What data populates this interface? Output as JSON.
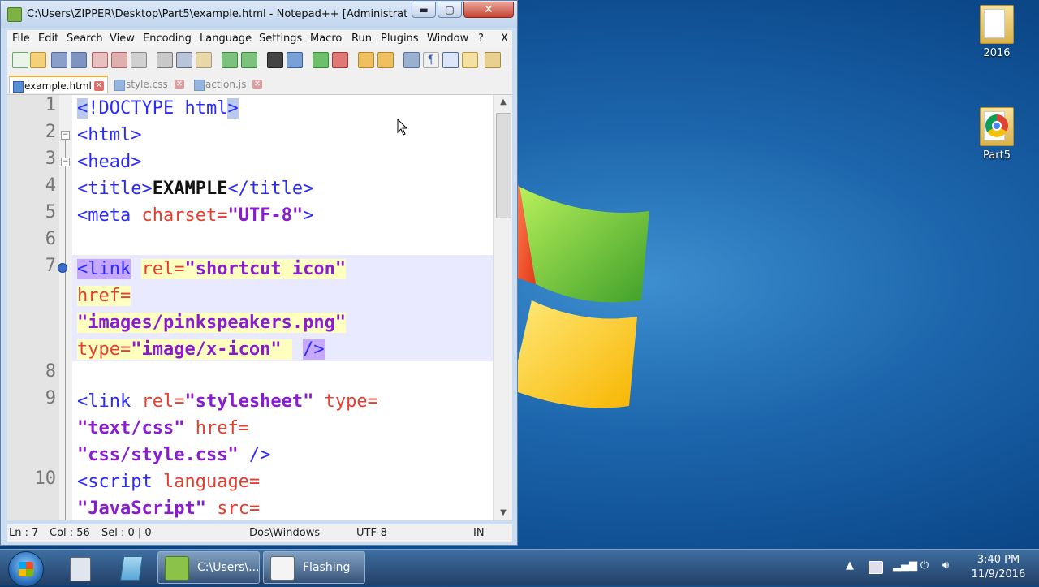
{
  "window": {
    "title": "C:\\Users\\ZIPPER\\Desktop\\Part5\\example.html - Notepad++ [Administrat...",
    "controls": {
      "minimize": "▬",
      "maximize": "▢",
      "close": "✕"
    }
  },
  "menu": [
    "File",
    "Edit",
    "Search",
    "View",
    "Encoding",
    "Language",
    "Settings",
    "Macro",
    "Run",
    "Plugins",
    "Window",
    "?",
    "X"
  ],
  "tabs": [
    {
      "label": "example.html",
      "active": true
    },
    {
      "label": "style.css",
      "active": false
    },
    {
      "label": "action.js",
      "active": false
    }
  ],
  "editor": {
    "line_numbers": [
      "1",
      "2",
      "3",
      "4",
      "5",
      "6",
      "7",
      "8",
      "9",
      "10"
    ],
    "lines": {
      "l1": [
        "<",
        "!",
        "DOCTYPE html",
        ">"
      ],
      "l2": "<html>",
      "l3": "<head>",
      "l4": [
        "<title>",
        "EXAMPLE",
        "</title>"
      ],
      "l5": [
        "<meta ",
        "charset=",
        "\"UTF-8\"",
        ">"
      ],
      "l7a": [
        "<link",
        " ",
        "rel=",
        "\"shortcut icon\""
      ],
      "l7b": "href=",
      "l7c": "\"images/pinkspeakers.png\"",
      "l7d": [
        "type=",
        "\"image/x-icon\"",
        " ",
        "/>"
      ],
      "l9a": [
        "<link ",
        "rel=",
        "\"stylesheet\"",
        " ",
        "type="
      ],
      "l9b": [
        "\"text/css\"",
        " ",
        "href="
      ],
      "l9c": [
        "\"css/style.css\"",
        " />"
      ],
      "l10a": [
        "<script ",
        "language="
      ],
      "l10b": [
        "\"JavaScript\"",
        " ",
        "src="
      ]
    }
  },
  "status": {
    "ln": "Ln : 7",
    "col": "Col : 56",
    "sel": "Sel : 0 | 0",
    "eol": "Dos\\Windows",
    "encoding": "UTF-8",
    "mode": "IN"
  },
  "desktop": {
    "icons": [
      "2016",
      "Part5"
    ]
  },
  "taskbar": {
    "buttons": [
      {
        "label": "C:\\Users\\..."
      },
      {
        "label": "Flashing"
      }
    ],
    "clock": {
      "time": "3:40 PM",
      "date": "11/9/2016"
    }
  }
}
